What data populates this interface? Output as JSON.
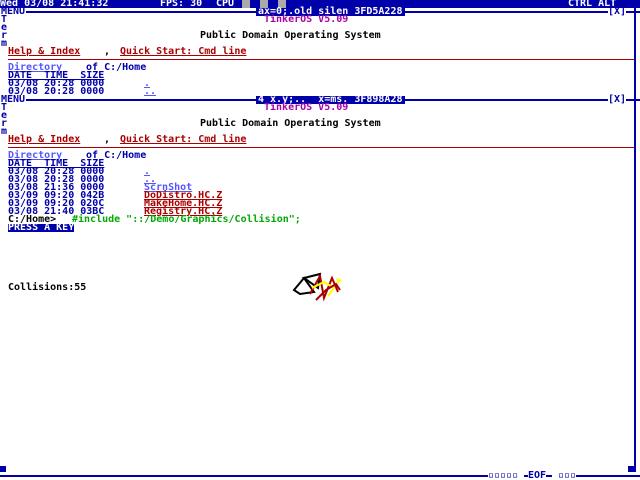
{
  "statusbar": {
    "clock": "Wed 03/08 21:41:32",
    "fps": "FPS: 30",
    "cpu_label": "CPU",
    "keys": "CTRL ALT"
  },
  "window1": {
    "menu": "MENU",
    "title": "ax=0;.old silen 3FD5A228",
    "close": "[X]",
    "os_name": "TinkerOS V5.09",
    "subtitle": "Public Domain Operating System",
    "help_link": "Help & Index",
    "quickstart_link": "Quick Start: Cmd line",
    "dir_link": "Directory",
    "dir_path": " of C:/Home",
    "col_header": "DATE_ TIME_ SIZE",
    "rows": [
      {
        "meta": "03/08 20:28 0000 ",
        "name": "."
      },
      {
        "meta": "03/08 20:28 0000 ",
        "name": ".."
      }
    ],
    "side_label": "Term"
  },
  "window2": {
    "menu": "MENU",
    "title": "4 x.y;..  x=ms. 3F898A28",
    "close": "[X]",
    "os_name": "TinkerOS V5.09",
    "subtitle": "Public Domain Operating System",
    "help_link": "Help & Index",
    "quickstart_link": "Quick Start: Cmd line",
    "dir_link": "Directory",
    "dir_path": " of C:/Home",
    "col_header": "DATE_ TIME_ SIZE",
    "rows": [
      {
        "meta": "03/08 20:28 0000 ",
        "name": "."
      },
      {
        "meta": "03/08 20:28 0000 ",
        "name": ".."
      },
      {
        "meta": "03/08 21:36 0000 ",
        "name": "ScrnShot"
      },
      {
        "meta": "03/09 09:20 042B ",
        "name": "DoDistro.HC.Z"
      },
      {
        "meta": "03/09 09:20 020C ",
        "name": "MakeHome.HC.Z"
      },
      {
        "meta": "03/08 21:40 03BC ",
        "name": "Registry.HC.Z"
      }
    ],
    "prompt": "C:/Home>",
    "command": "#include \"::/Demo/Graphics/Collision\";",
    "press_key": "PRESS A KEY",
    "collisions_label": "Collisions:55",
    "side_label": "Term"
  },
  "bottom": {
    "ticks": "▫▫▫▫▫ ",
    "eof": "EOF",
    "ticks2": " ▫▫▫"
  },
  "colors": {
    "accent": "#0000aa",
    "link_red": "#aa0000",
    "link_blue": "#5555ff",
    "title_purple": "#aa00aa",
    "cmd_green": "#00aa00"
  }
}
